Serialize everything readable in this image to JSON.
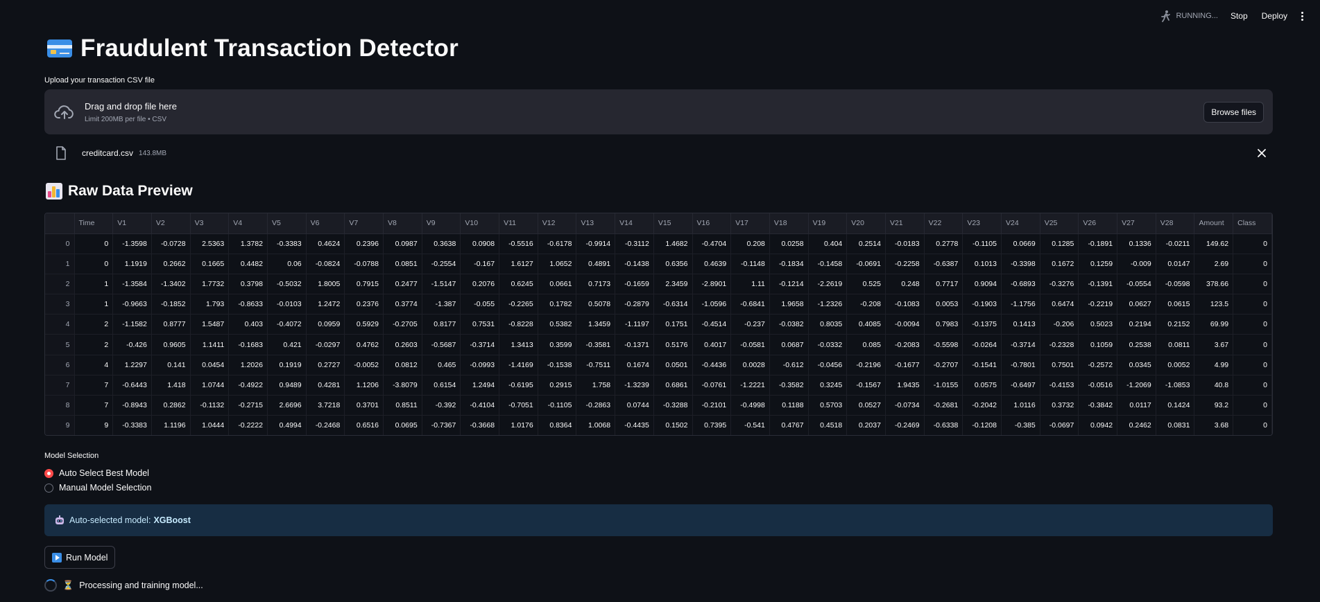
{
  "topbar": {
    "status": "RUNNING...",
    "stop": "Stop",
    "deploy": "Deploy"
  },
  "header": {
    "title": "Fraudulent Transaction Detector"
  },
  "upload": {
    "label": "Upload your transaction CSV file",
    "drop_text": "Drag and drop file here",
    "limit_text": "Limit 200MB per file • CSV",
    "browse": "Browse files",
    "file_name": "creditcard.csv",
    "file_size": "143.8MB"
  },
  "preview": {
    "title": "Raw Data Preview",
    "columns": [
      "",
      "Time",
      "V1",
      "V2",
      "V3",
      "V4",
      "V5",
      "V6",
      "V7",
      "V8",
      "V9",
      "V10",
      "V11",
      "V12",
      "V13",
      "V14",
      "V15",
      "V16",
      "V17",
      "V18",
      "V19",
      "V20",
      "V21",
      "V22",
      "V23",
      "V24",
      "V25",
      "V26",
      "V27",
      "V28",
      "Amount",
      "Class"
    ],
    "rows": [
      [
        "0",
        "0",
        "-1.3598",
        "-0.0728",
        "2.5363",
        "1.3782",
        "-0.3383",
        "0.4624",
        "0.2396",
        "0.0987",
        "0.3638",
        "0.0908",
        "-0.5516",
        "-0.6178",
        "-0.9914",
        "-0.3112",
        "1.4682",
        "-0.4704",
        "0.208",
        "0.0258",
        "0.404",
        "0.2514",
        "-0.0183",
        "0.2778",
        "-0.1105",
        "0.0669",
        "0.1285",
        "-0.1891",
        "0.1336",
        "-0.0211",
        "149.62",
        "0"
      ],
      [
        "1",
        "0",
        "1.1919",
        "0.2662",
        "0.1665",
        "0.4482",
        "0.06",
        "-0.0824",
        "-0.0788",
        "0.0851",
        "-0.2554",
        "-0.167",
        "1.6127",
        "1.0652",
        "0.4891",
        "-0.1438",
        "0.6356",
        "0.4639",
        "-0.1148",
        "-0.1834",
        "-0.1458",
        "-0.0691",
        "-0.2258",
        "-0.6387",
        "0.1013",
        "-0.3398",
        "0.1672",
        "0.1259",
        "-0.009",
        "0.0147",
        "2.69",
        "0"
      ],
      [
        "2",
        "1",
        "-1.3584",
        "-1.3402",
        "1.7732",
        "0.3798",
        "-0.5032",
        "1.8005",
        "0.7915",
        "0.2477",
        "-1.5147",
        "0.2076",
        "0.6245",
        "0.0661",
        "0.7173",
        "-0.1659",
        "2.3459",
        "-2.8901",
        "1.11",
        "-0.1214",
        "-2.2619",
        "0.525",
        "0.248",
        "0.7717",
        "0.9094",
        "-0.6893",
        "-0.3276",
        "-0.1391",
        "-0.0554",
        "-0.0598",
        "378.66",
        "0"
      ],
      [
        "3",
        "1",
        "-0.9663",
        "-0.1852",
        "1.793",
        "-0.8633",
        "-0.0103",
        "1.2472",
        "0.2376",
        "0.3774",
        "-1.387",
        "-0.055",
        "-0.2265",
        "0.1782",
        "0.5078",
        "-0.2879",
        "-0.6314",
        "-1.0596",
        "-0.6841",
        "1.9658",
        "-1.2326",
        "-0.208",
        "-0.1083",
        "0.0053",
        "-0.1903",
        "-1.1756",
        "0.6474",
        "-0.2219",
        "0.0627",
        "0.0615",
        "123.5",
        "0"
      ],
      [
        "4",
        "2",
        "-1.1582",
        "0.8777",
        "1.5487",
        "0.403",
        "-0.4072",
        "0.0959",
        "0.5929",
        "-0.2705",
        "0.8177",
        "0.7531",
        "-0.8228",
        "0.5382",
        "1.3459",
        "-1.1197",
        "0.1751",
        "-0.4514",
        "-0.237",
        "-0.0382",
        "0.8035",
        "0.4085",
        "-0.0094",
        "0.7983",
        "-0.1375",
        "0.1413",
        "-0.206",
        "0.5023",
        "0.2194",
        "0.2152",
        "69.99",
        "0"
      ],
      [
        "5",
        "2",
        "-0.426",
        "0.9605",
        "1.1411",
        "-0.1683",
        "0.421",
        "-0.0297",
        "0.4762",
        "0.2603",
        "-0.5687",
        "-0.3714",
        "1.3413",
        "0.3599",
        "-0.3581",
        "-0.1371",
        "0.5176",
        "0.4017",
        "-0.0581",
        "0.0687",
        "-0.0332",
        "0.085",
        "-0.2083",
        "-0.5598",
        "-0.0264",
        "-0.3714",
        "-0.2328",
        "0.1059",
        "0.2538",
        "0.0811",
        "3.67",
        "0"
      ],
      [
        "6",
        "4",
        "1.2297",
        "0.141",
        "0.0454",
        "1.2026",
        "0.1919",
        "0.2727",
        "-0.0052",
        "0.0812",
        "0.465",
        "-0.0993",
        "-1.4169",
        "-0.1538",
        "-0.7511",
        "0.1674",
        "0.0501",
        "-0.4436",
        "0.0028",
        "-0.612",
        "-0.0456",
        "-0.2196",
        "-0.1677",
        "-0.2707",
        "-0.1541",
        "-0.7801",
        "0.7501",
        "-0.2572",
        "0.0345",
        "0.0052",
        "4.99",
        "0"
      ],
      [
        "7",
        "7",
        "-0.6443",
        "1.418",
        "1.0744",
        "-0.4922",
        "0.9489",
        "0.4281",
        "1.1206",
        "-3.8079",
        "0.6154",
        "1.2494",
        "-0.6195",
        "0.2915",
        "1.758",
        "-1.3239",
        "0.6861",
        "-0.0761",
        "-1.2221",
        "-0.3582",
        "0.3245",
        "-0.1567",
        "1.9435",
        "-1.0155",
        "0.0575",
        "-0.6497",
        "-0.4153",
        "-0.0516",
        "-1.2069",
        "-1.0853",
        "40.8",
        "0"
      ],
      [
        "8",
        "7",
        "-0.8943",
        "0.2862",
        "-0.1132",
        "-0.2715",
        "2.6696",
        "3.7218",
        "0.3701",
        "0.8511",
        "-0.392",
        "-0.4104",
        "-0.7051",
        "-0.1105",
        "-0.2863",
        "0.0744",
        "-0.3288",
        "-0.2101",
        "-0.4998",
        "0.1188",
        "0.5703",
        "0.0527",
        "-0.0734",
        "-0.2681",
        "-0.2042",
        "1.0116",
        "0.3732",
        "-0.3842",
        "0.0117",
        "0.1424",
        "93.2",
        "0"
      ],
      [
        "9",
        "9",
        "-0.3383",
        "1.1196",
        "1.0444",
        "-0.2222",
        "0.4994",
        "-0.2468",
        "0.6516",
        "0.0695",
        "-0.7367",
        "-0.3668",
        "1.0176",
        "0.8364",
        "1.0068",
        "-0.4435",
        "0.1502",
        "0.7395",
        "-0.541",
        "0.4767",
        "0.4518",
        "0.2037",
        "-0.2469",
        "-0.6338",
        "-0.1208",
        "-0.385",
        "-0.0697",
        "0.0942",
        "0.2462",
        "0.0831",
        "3.68",
        "0"
      ]
    ]
  },
  "model": {
    "label": "Model Selection",
    "options": [
      "Auto Select Best Model",
      "Manual Model Selection"
    ],
    "selected": 0,
    "info_prefix": "Auto-selected model:",
    "info_model": "XGBoost",
    "run_label": "Run Model",
    "processing": "Processing and training model..."
  },
  "colors": {
    "accent": "#ff4b4b",
    "info_bg": "#172d43",
    "background": "#0e1117"
  }
}
